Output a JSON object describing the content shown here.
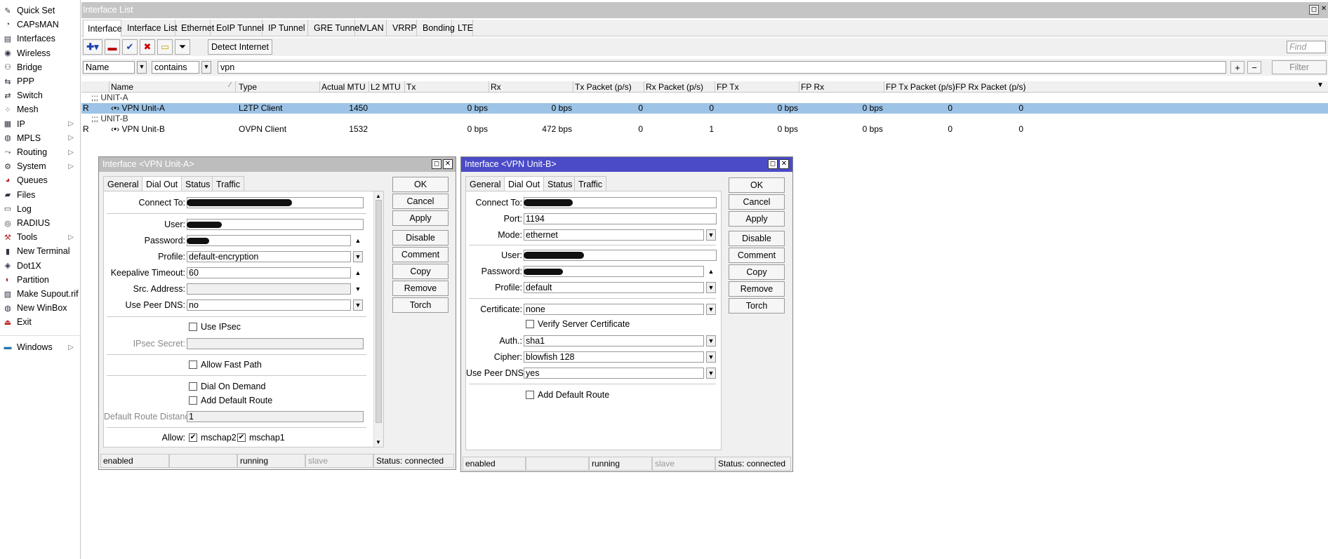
{
  "sidebar": {
    "items": [
      {
        "label": "Quick Set",
        "icon": "wand-icon",
        "sub": false
      },
      {
        "label": "CAPsMAN",
        "icon": "capsman-icon",
        "sub": false
      },
      {
        "label": "Interfaces",
        "icon": "interfaces-icon",
        "sub": false
      },
      {
        "label": "Wireless",
        "icon": "wireless-icon",
        "sub": false
      },
      {
        "label": "Bridge",
        "icon": "bridge-icon",
        "sub": false
      },
      {
        "label": "PPP",
        "icon": "ppp-icon",
        "sub": false
      },
      {
        "label": "Switch",
        "icon": "switch-icon",
        "sub": false
      },
      {
        "label": "Mesh",
        "icon": "mesh-icon",
        "sub": false
      },
      {
        "label": "IP",
        "icon": "ip-icon",
        "sub": true
      },
      {
        "label": "MPLS",
        "icon": "mpls-icon",
        "sub": true
      },
      {
        "label": "Routing",
        "icon": "routing-icon",
        "sub": true
      },
      {
        "label": "System",
        "icon": "gear-icon",
        "sub": true
      },
      {
        "label": "Queues",
        "icon": "queues-icon",
        "sub": false
      },
      {
        "label": "Files",
        "icon": "folder-icon",
        "sub": false
      },
      {
        "label": "Log",
        "icon": "log-icon",
        "sub": false
      },
      {
        "label": "RADIUS",
        "icon": "radius-icon",
        "sub": false
      },
      {
        "label": "Tools",
        "icon": "tools-icon",
        "sub": true
      },
      {
        "label": "New Terminal",
        "icon": "terminal-icon",
        "sub": false
      },
      {
        "label": "Dot1X",
        "icon": "dot1x-icon",
        "sub": false
      },
      {
        "label": "Partition",
        "icon": "partition-icon",
        "sub": false
      },
      {
        "label": "Make Supout.rif",
        "icon": "supout-icon",
        "sub": false
      },
      {
        "label": "New WinBox",
        "icon": "winbox-icon",
        "sub": false
      },
      {
        "label": "Exit",
        "icon": "exit-icon",
        "sub": false
      }
    ],
    "windows": {
      "label": "Windows",
      "icon": "windows-icon"
    }
  },
  "window": {
    "title": "Interface List",
    "restore": "◻",
    "close": "✕"
  },
  "tabs": [
    "Interface",
    "Interface List",
    "Ethernet",
    "EoIP Tunnel",
    "IP Tunnel",
    "GRE Tunnel",
    "VLAN",
    "VRRP",
    "Bonding",
    "LTE"
  ],
  "toolbar": {
    "detect_label": "Detect Internet",
    "find_placeholder": "Find"
  },
  "filter": {
    "field": "Name",
    "op": "contains",
    "value": "vpn",
    "plus": "+",
    "minus": "−",
    "button": "Filter"
  },
  "table": {
    "columns": [
      "Name",
      "Type",
      "Actual MTU",
      "L2 MTU",
      "Tx",
      "Rx",
      "Tx Packet (p/s)",
      "Rx Packet (p/s)",
      "FP Tx",
      "FP Rx",
      "FP Tx Packet (p/s)",
      "FP Rx Packet (p/s)"
    ],
    "groups": [
      {
        "comment": ";;; UNIT-A",
        "flag": "R",
        "name": "VPN Unit-A",
        "type": "L2TP Client",
        "mtu": "1450",
        "l2mtu": "",
        "tx": "0 bps",
        "rx": "0 bps",
        "txp": "0",
        "rxp": "0",
        "fptx": "0 bps",
        "fprx": "0 bps",
        "fptxp": "0",
        "fprxp": "0",
        "selected": true
      },
      {
        "comment": ";;; UNIT-B",
        "flag": "R",
        "name": "VPN Unit-B",
        "type": "OVPN Client",
        "mtu": "1532",
        "l2mtu": "",
        "tx": "0 bps",
        "rx": "472 bps",
        "txp": "0",
        "rxp": "1",
        "fptx": "0 bps",
        "fprx": "0 bps",
        "fptxp": "0",
        "fprxp": "0",
        "selected": false
      }
    ]
  },
  "dialogA": {
    "title": "Interface <VPN Unit-A>",
    "tabs": [
      "General",
      "Dial Out",
      "Status",
      "Traffic"
    ],
    "labels": {
      "connect": "Connect To:",
      "user": "User:",
      "password": "Password:",
      "profile": "Profile:",
      "keepalive": "Keepalive Timeout:",
      "src": "Src. Address:",
      "peerdns": "Use Peer DNS:",
      "ipsec": "Use IPsec",
      "ipsec_secret": "IPsec Secret:",
      "fastpath": "Allow Fast Path",
      "dialdemand": "Dial On Demand",
      "defroute": "Add Default Route",
      "defdist": "Default Route Distance:",
      "allow": "Allow:",
      "mschap2": "mschap2",
      "mschap1": "mschap1"
    },
    "values": {
      "profile": "default-encryption",
      "keepalive": "60",
      "peerdns": "no",
      "defdist": "1"
    },
    "buttons": [
      "OK",
      "Cancel",
      "Apply",
      "Disable",
      "Comment",
      "Copy",
      "Remove",
      "Torch"
    ],
    "status": [
      "enabled",
      "",
      "running",
      "slave",
      "Status: connected"
    ]
  },
  "dialogB": {
    "title": "Interface <VPN Unit-B>",
    "tabs": [
      "General",
      "Dial Out",
      "Status",
      "Traffic"
    ],
    "labels": {
      "connect": "Connect To:",
      "port": "Port:",
      "mode": "Mode:",
      "user": "User:",
      "password": "Password:",
      "profile": "Profile:",
      "cert": "Certificate:",
      "verify": "Verify Server Certificate",
      "auth": "Auth.:",
      "cipher": "Cipher:",
      "peerdns": "Use Peer DNS:",
      "defroute": "Add Default Route"
    },
    "values": {
      "port": "1194",
      "mode": "ethernet",
      "profile": "default",
      "cert": "none",
      "auth": "sha1",
      "cipher": "blowfish 128",
      "peerdns": "yes"
    },
    "buttons": [
      "OK",
      "Cancel",
      "Apply",
      "Disable",
      "Comment",
      "Copy",
      "Remove",
      "Torch"
    ],
    "status": [
      "enabled",
      "",
      "running",
      "slave",
      "Status: connected"
    ]
  },
  "colors": {
    "selected_row": "#9dc3e6",
    "active_title": "#4b4bc8",
    "inactive_title": "#bdbdbd"
  }
}
